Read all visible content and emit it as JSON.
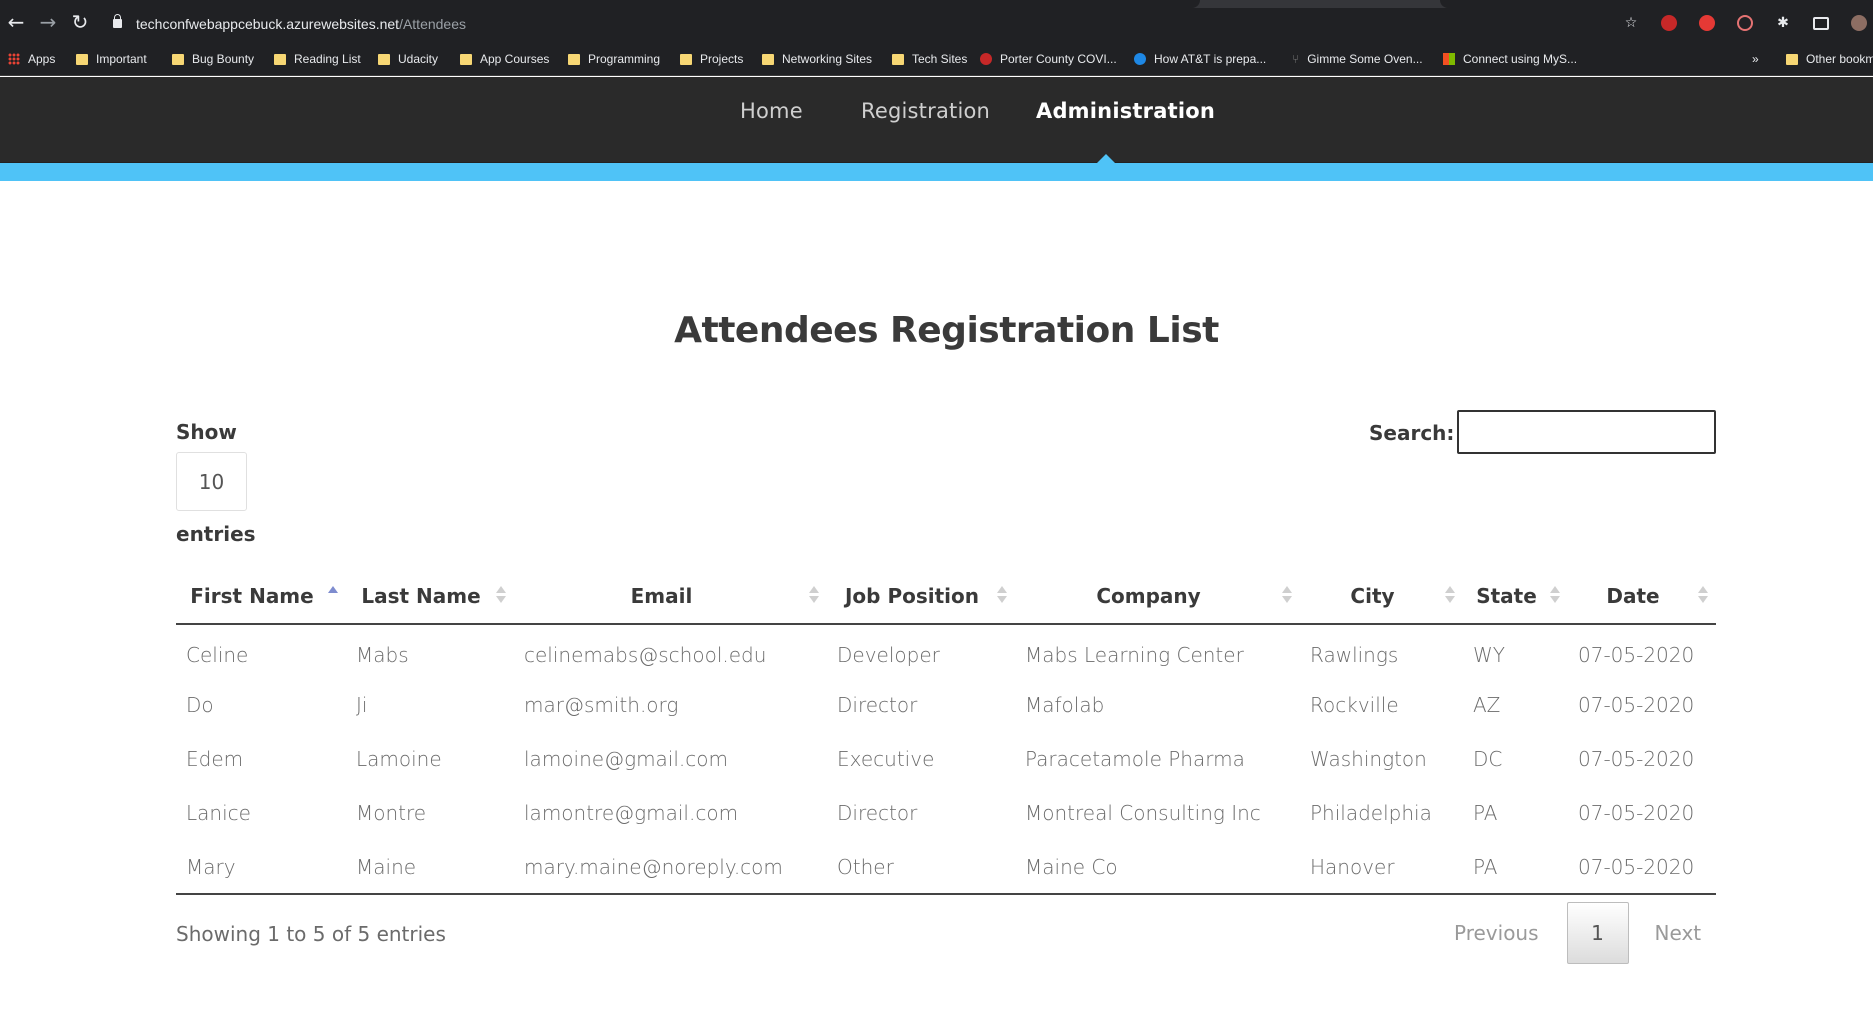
{
  "browser": {
    "url_host": "techconfwebappcebuck.azurewebsites.net",
    "url_path": "/Attendees",
    "bookmarks": [
      {
        "label": "Apps",
        "icon": "apps-icon"
      },
      {
        "label": "Important",
        "icon": "folder-icon"
      },
      {
        "label": "Bug Bounty",
        "icon": "folder-icon"
      },
      {
        "label": "Reading List",
        "icon": "folder-icon"
      },
      {
        "label": "Udacity",
        "icon": "folder-icon"
      },
      {
        "label": "App Courses",
        "icon": "folder-icon"
      },
      {
        "label": "Programming",
        "icon": "folder-icon"
      },
      {
        "label": "Projects",
        "icon": "folder-icon"
      },
      {
        "label": "Networking Sites",
        "icon": "folder-icon"
      },
      {
        "label": "Tech Sites",
        "icon": "folder-icon"
      },
      {
        "label": "Porter County COVI...",
        "icon": "site-icon"
      },
      {
        "label": "How AT&T is prepa...",
        "icon": "att-icon"
      },
      {
        "label": "Gimme Some Oven...",
        "icon": "fork-icon"
      },
      {
        "label": "Connect using MyS...",
        "icon": "windows-icon"
      },
      {
        "label": "»",
        "icon": "more-icon"
      },
      {
        "label": "Other bookm",
        "icon": "folder-icon"
      }
    ]
  },
  "nav": {
    "home": "Home",
    "registration": "Registration",
    "administration": "Administration"
  },
  "page": {
    "title": "Attendees Registration List"
  },
  "table_controls": {
    "show_label": "Show",
    "page_length": "10",
    "entries_label": "entries",
    "search_label": "Search:",
    "search_value": ""
  },
  "table": {
    "columns": [
      "First Name",
      "Last Name",
      "Email",
      "Job Position",
      "Company",
      "City",
      "State",
      "Date"
    ],
    "rows": [
      [
        "Celine",
        "Mabs",
        "celinemabs@school.edu",
        "Developer",
        "Mabs Learning Center",
        "Rawlings",
        "WY",
        "07-05-2020"
      ],
      [
        "Do",
        "Ji",
        "mar@smith.org",
        "Director",
        "Mafolab",
        "Rockville",
        "AZ",
        "07-05-2020"
      ],
      [
        "Edem",
        "Lamoine",
        "lamoine@gmail.com",
        "Executive",
        "Paracetamole Pharma",
        "Washington",
        "DC",
        "07-05-2020"
      ],
      [
        "Lanice",
        "Montre",
        "lamontre@gmail.com",
        "Director",
        "Montreal Consulting Inc",
        "Philadelphia",
        "PA",
        "07-05-2020"
      ],
      [
        "Mary",
        "Maine",
        "mary.maine@noreply.com",
        "Other",
        "Maine Co",
        "Hanover",
        "PA",
        "07-05-2020"
      ]
    ]
  },
  "footer": {
    "info": "Showing 1 to 5 of 5 entries",
    "previous": "Previous",
    "current_page": "1",
    "next": "Next"
  },
  "colors": {
    "accent": "#4fc3f7",
    "nav_bg": "#2a2a2a",
    "sort_active": "#7e8ccf"
  }
}
